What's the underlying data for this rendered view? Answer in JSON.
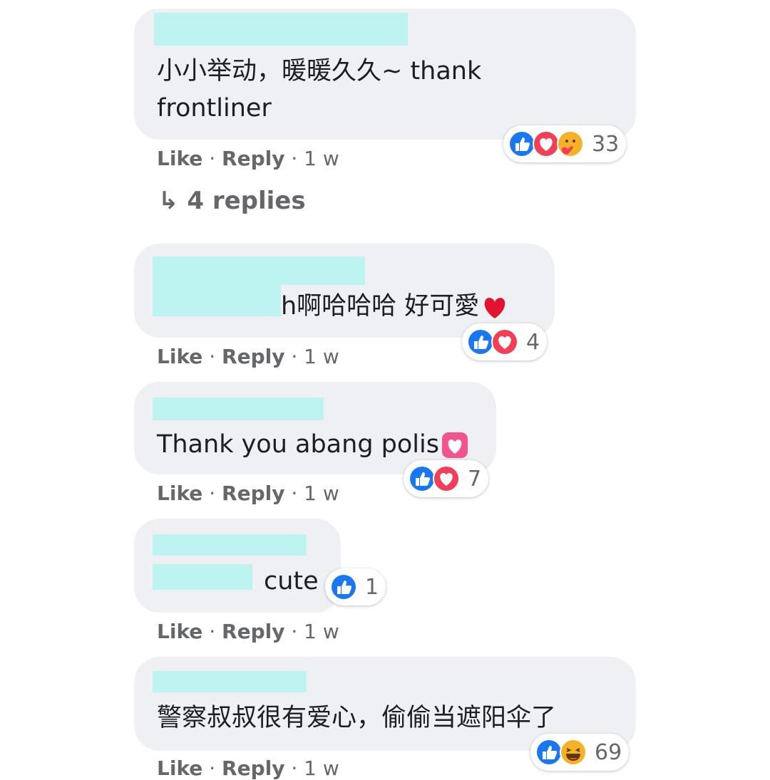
{
  "comments": [
    {
      "text_line1": "小小举动，暖暖久久~ thank",
      "text_line2": "frontliner",
      "actions": {
        "like": "Like",
        "reply": "Reply",
        "time": "1 w"
      },
      "reaction_icons": [
        "like-icon",
        "love-icon",
        "care-icon"
      ],
      "reaction_count": "33"
    },
    {
      "text_line1": "h啊哈哈哈 好可愛",
      "inline_emoji": "red-heart-emoji",
      "actions": {
        "like": "Like",
        "reply": "Reply",
        "time": "1 w"
      },
      "reaction_icons": [
        "like-icon",
        "love-icon"
      ],
      "reaction_count": "4"
    },
    {
      "text_line1": "Thank you abang polis",
      "inline_emoji": "heart-box-emoji",
      "actions": {
        "like": "Like",
        "reply": "Reply",
        "time": "1 w"
      },
      "reaction_icons": [
        "like-icon",
        "love-icon"
      ],
      "reaction_count": "7"
    },
    {
      "text_line1": "cute",
      "actions": {
        "like": "Like",
        "reply": "Reply",
        "time": "1 w"
      },
      "reaction_icons": [
        "like-icon"
      ],
      "reaction_count": "1"
    },
    {
      "text_line1": "警察叔叔很有爱心，偷偷当遮阳伞了",
      "actions": {
        "like": "Like",
        "reply": "Reply",
        "time": "1 w"
      },
      "reaction_icons": [
        "like-icon",
        "haha-icon"
      ],
      "reaction_count": "69"
    }
  ],
  "replies_link": {
    "arrow": "↳",
    "label": "4 replies"
  },
  "colors": {
    "bubble": "#eef0f3",
    "redaction": "#bdf3f1",
    "like_blue": "#1877f2",
    "love_red": "#f33e58",
    "care_yellow": "#f7b125",
    "meta_text": "#65676b"
  }
}
